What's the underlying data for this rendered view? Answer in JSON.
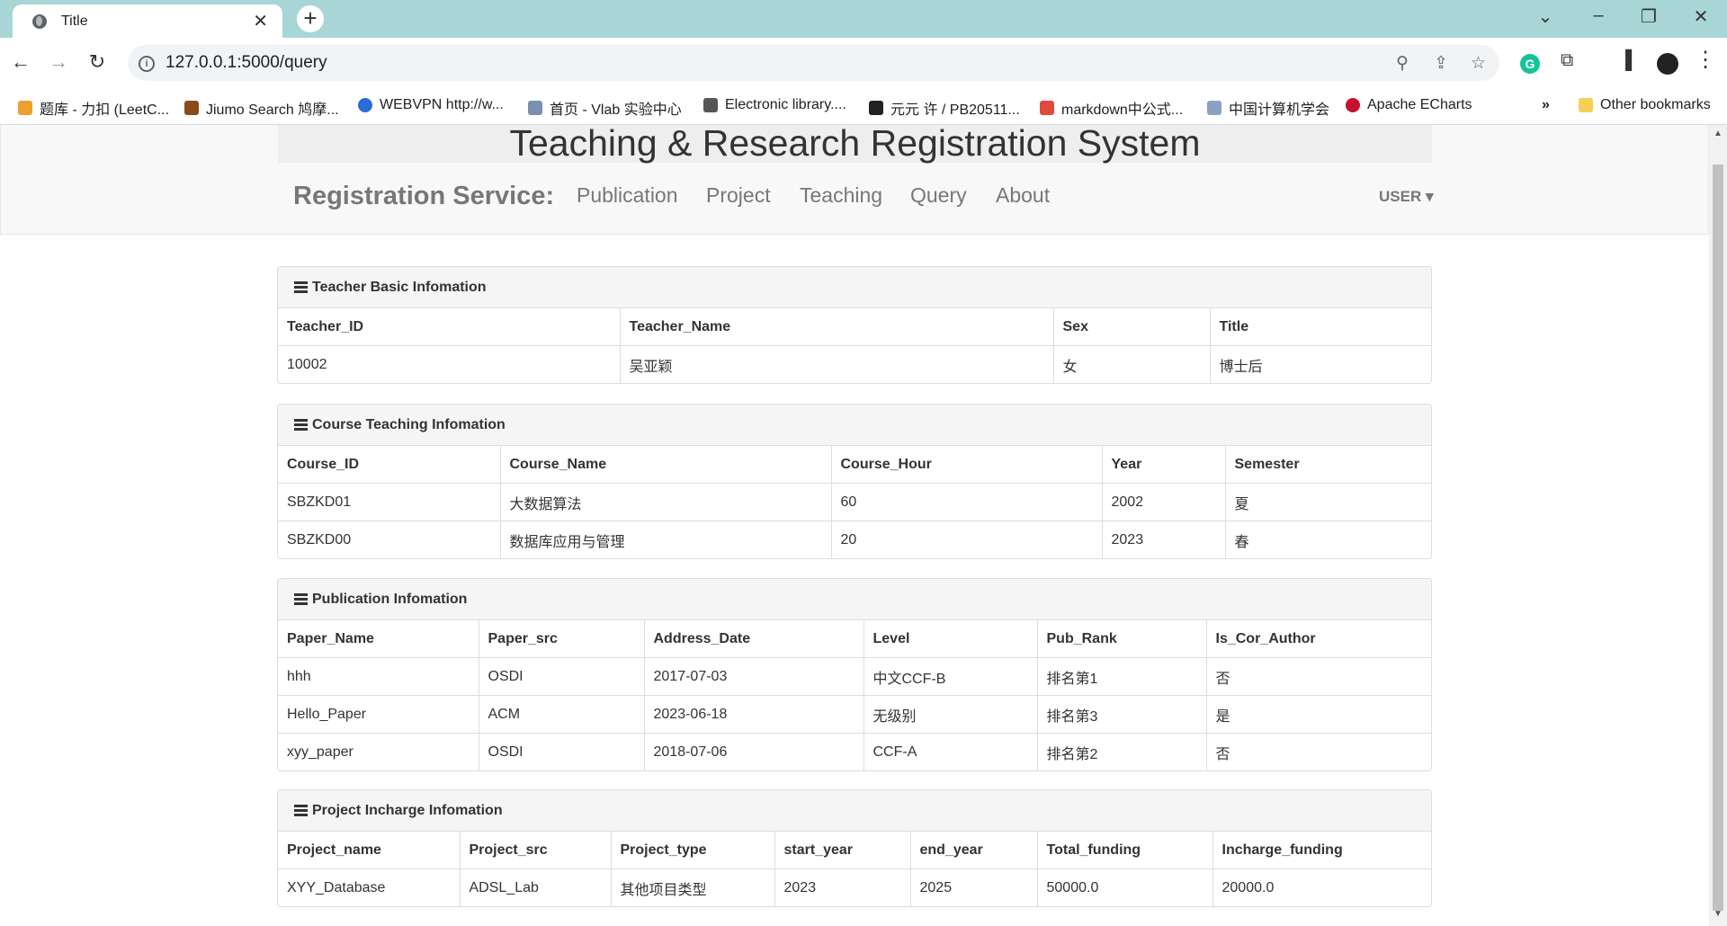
{
  "browser": {
    "tab_title": "Title",
    "url": "127.0.0.1:5000/query",
    "bookmarks": [
      {
        "label": "题库 - 力扣 (LeetC...",
        "color": "#f0a030"
      },
      {
        "label": "Jiumo Search 鸠摩...",
        "color": "#8a4b1c"
      },
      {
        "label": "WEBVPN http://w...",
        "color": "#2b6cd6"
      },
      {
        "label": "首页 - Vlab 实验中心",
        "color": "#7b8fb0"
      },
      {
        "label": "Electronic library....",
        "color": "#555555"
      },
      {
        "label": "元元 许 / PB20511...",
        "color": "#222222"
      },
      {
        "label": "markdown中公式...",
        "color": "#e0493c"
      },
      {
        "label": "中国计算机学会",
        "color": "#8aa1c4"
      },
      {
        "label": "Apache ECharts",
        "color": "#c8102e"
      }
    ],
    "bookmarks_more": "»",
    "other_bookmarks": "Other bookmarks"
  },
  "page": {
    "title": "Teaching & Research Registration System",
    "brand": "Registration Service:",
    "nav": [
      "Publication",
      "Project",
      "Teaching",
      "Query",
      "About"
    ],
    "user_menu": "USER ▾"
  },
  "teacher": {
    "heading": "Teacher Basic Infomation",
    "columns": [
      "Teacher_ID",
      "Teacher_Name",
      "Sex",
      "Title"
    ],
    "rows": [
      [
        "10002",
        "吴亚颖",
        "女",
        "博士后"
      ]
    ]
  },
  "courses": {
    "heading": "Course Teaching Infomation",
    "columns": [
      "Course_ID",
      "Course_Name",
      "Course_Hour",
      "Year",
      "Semester"
    ],
    "rows": [
      [
        "SBZKD01",
        "大数据算法",
        "60",
        "2002",
        "夏"
      ],
      [
        "SBZKD00",
        "数据库应用与管理",
        "20",
        "2023",
        "春"
      ]
    ]
  },
  "publications": {
    "heading": "Publication Infomation",
    "columns": [
      "Paper_Name",
      "Paper_src",
      "Address_Date",
      "Level",
      "Pub_Rank",
      "Is_Cor_Author"
    ],
    "rows": [
      [
        "hhh",
        "OSDI",
        "2017-07-03",
        "中文CCF-B",
        "排名第1",
        "否"
      ],
      [
        "Hello_Paper",
        "ACM",
        "2023-06-18",
        "无级别",
        "排名第3",
        "是"
      ],
      [
        "xyy_paper",
        "OSDI",
        "2018-07-06",
        "CCF-A",
        "排名第2",
        "否"
      ]
    ]
  },
  "projects": {
    "heading": "Project Incharge Infomation",
    "columns": [
      "Project_name",
      "Project_src",
      "Project_type",
      "start_year",
      "end_year",
      "Total_funding",
      "Incharge_funding"
    ],
    "rows": [
      [
        "XYY_Database",
        "ADSL_Lab",
        "其他项目类型",
        "2023",
        "2025",
        "50000.0",
        "20000.0"
      ]
    ]
  }
}
